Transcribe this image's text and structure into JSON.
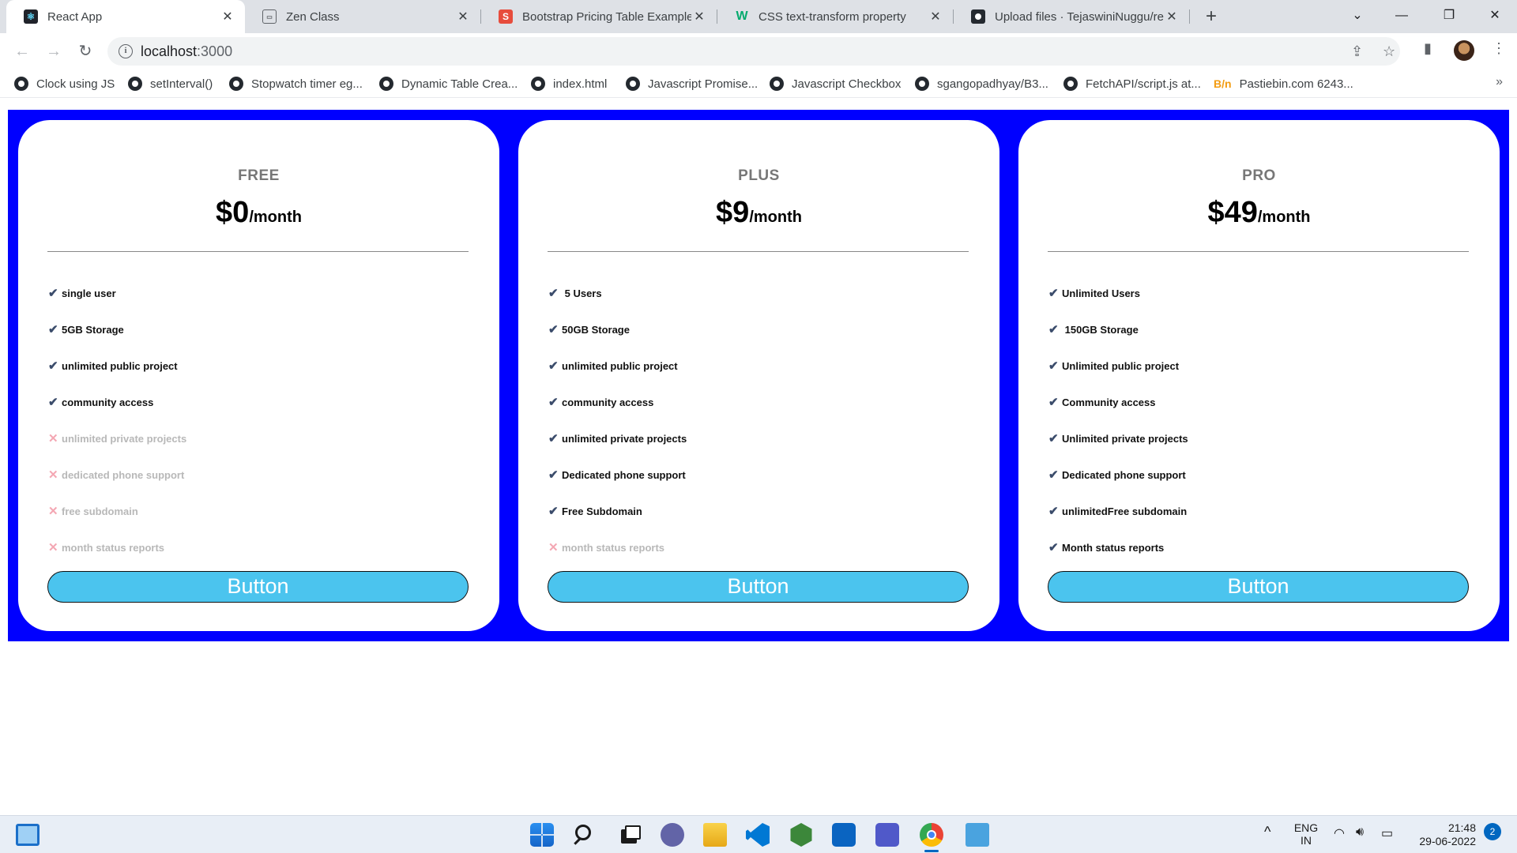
{
  "browser": {
    "tabs": [
      {
        "title": "React App",
        "active": true,
        "icon": "react-icon"
      },
      {
        "title": "Zen Class",
        "active": false,
        "icon": "zen-class-icon"
      },
      {
        "title": "Bootstrap Pricing Table Example",
        "active": false,
        "icon": "s-logo-icon"
      },
      {
        "title": "CSS text-transform property",
        "active": false,
        "icon": "w-logo-icon"
      },
      {
        "title": "Upload files · TejaswiniNuggu/re",
        "active": false,
        "icon": "github-icon"
      }
    ],
    "url": {
      "host": "localhost",
      "port": ":3000"
    },
    "bookmarks": [
      "Clock using JS",
      "setInterval()",
      "Stopwatch timer eg...",
      "Dynamic Table Crea...",
      "index.html",
      "Javascript Promise...",
      "Javascript Checkbox",
      "sgangopadhyay/B3...",
      "FetchAPI/script.js at...",
      "Pastiebin.com 6243..."
    ]
  },
  "pricing": {
    "button_label": "Button",
    "plans": [
      {
        "name": "FREE",
        "price": "$0",
        "period": "/month",
        "features": [
          {
            "text": "single user",
            "included": true
          },
          {
            "text": "5GB Storage",
            "included": true
          },
          {
            "text": "unlimited public project",
            "included": true
          },
          {
            "text": "community access",
            "included": true
          },
          {
            "text": "unlimited private projects",
            "included": false
          },
          {
            "text": "dedicated phone support",
            "included": false
          },
          {
            "text": "free subdomain",
            "included": false
          },
          {
            "text": "month status reports",
            "included": false
          }
        ]
      },
      {
        "name": "PLUS",
        "price": "$9",
        "period": "/month",
        "features": [
          {
            "text": " 5 Users",
            "included": true
          },
          {
            "text": "50GB Storage",
            "included": true
          },
          {
            "text": "unlimited public project",
            "included": true
          },
          {
            "text": "community access",
            "included": true
          },
          {
            "text": "unlimited private projects",
            "included": true
          },
          {
            "text": "Dedicated phone support",
            "included": true
          },
          {
            "text": "Free Subdomain",
            "included": true
          },
          {
            "text": "month status reports",
            "included": false
          }
        ]
      },
      {
        "name": "PRO",
        "price": "$49",
        "period": "/month",
        "features": [
          {
            "text": "Unlimited Users",
            "included": true
          },
          {
            "text": " 150GB Storage",
            "included": true
          },
          {
            "text": "Unlimited public project",
            "included": true
          },
          {
            "text": "Community access",
            "included": true
          },
          {
            "text": "Unlimited private projects",
            "included": true
          },
          {
            "text": "Dedicated phone support",
            "included": true
          },
          {
            "text": "unlimitedFree subdomain",
            "included": true
          },
          {
            "text": "Month status reports",
            "included": true
          }
        ]
      }
    ]
  },
  "taskbar": {
    "language": "ENG",
    "region": "IN",
    "time": "21:48",
    "date": "29-06-2022",
    "notifications": "2"
  }
}
